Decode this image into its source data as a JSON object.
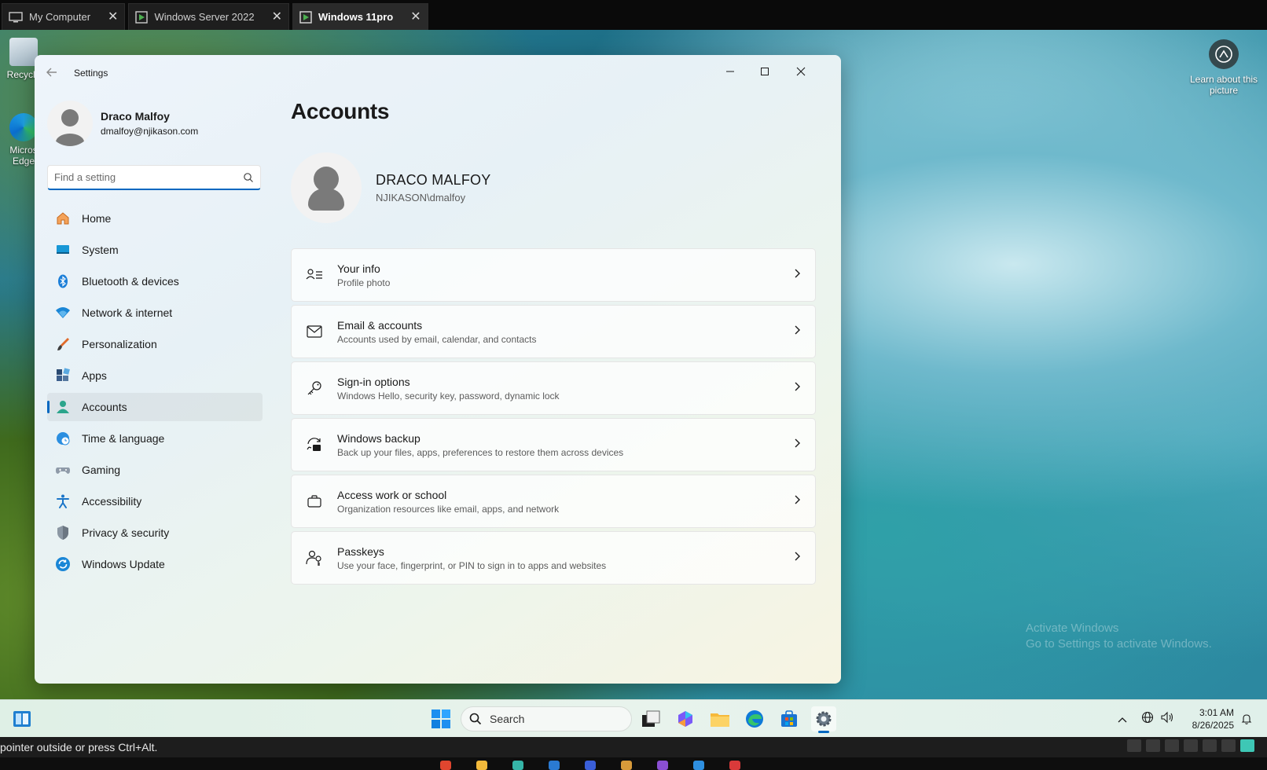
{
  "vm_tabs": [
    {
      "label": "My Computer",
      "active": false
    },
    {
      "label": "Windows Server 2022",
      "active": false
    },
    {
      "label": "Windows 11pro",
      "active": true
    }
  ],
  "desktop": {
    "icons": [
      {
        "label": "Recycle"
      },
      {
        "label": "Micros Edge"
      }
    ],
    "learn_picture": "Learn about this picture",
    "watermark_line1": "Activate Windows",
    "watermark_line2": "Go to Settings to activate Windows."
  },
  "settings": {
    "title": "Settings",
    "profile": {
      "name": "Draco Malfoy",
      "email": "dmalfoy@njikason.com"
    },
    "search": {
      "placeholder": "Find a setting"
    },
    "nav": [
      {
        "label": "Home",
        "icon": "home-icon"
      },
      {
        "label": "System",
        "icon": "system-icon"
      },
      {
        "label": "Bluetooth & devices",
        "icon": "bluetooth-icon"
      },
      {
        "label": "Network & internet",
        "icon": "wifi-icon"
      },
      {
        "label": "Personalization",
        "icon": "brush-icon"
      },
      {
        "label": "Apps",
        "icon": "apps-icon"
      },
      {
        "label": "Accounts",
        "icon": "accounts-icon",
        "active": true
      },
      {
        "label": "Time & language",
        "icon": "clock-globe-icon"
      },
      {
        "label": "Gaming",
        "icon": "gamepad-icon"
      },
      {
        "label": "Accessibility",
        "icon": "accessibility-icon"
      },
      {
        "label": "Privacy & security",
        "icon": "shield-icon"
      },
      {
        "label": "Windows Update",
        "icon": "update-icon"
      }
    ],
    "page_title": "Accounts",
    "account": {
      "name": "DRACO MALFOY",
      "domain": "NJIKASON\\dmalfoy"
    },
    "cards": [
      {
        "title": "Your info",
        "subtitle": "Profile photo",
        "icon": "person-list-icon"
      },
      {
        "title": "Email & accounts",
        "subtitle": "Accounts used by email, calendar, and contacts",
        "icon": "mail-icon"
      },
      {
        "title": "Sign-in options",
        "subtitle": "Windows Hello, security key, password, dynamic lock",
        "icon": "key-icon"
      },
      {
        "title": "Windows backup",
        "subtitle": "Back up your files, apps, preferences to restore them across devices",
        "icon": "backup-icon"
      },
      {
        "title": "Access work or school",
        "subtitle": "Organization resources like email, apps, and network",
        "icon": "briefcase-icon"
      },
      {
        "title": "Passkeys",
        "subtitle": "Use your face, fingerprint, or PIN to sign in to apps and websites",
        "icon": "passkey-icon"
      }
    ]
  },
  "taskbar": {
    "search_label": "Search",
    "time": "3:01 AM",
    "date": "8/26/2025"
  },
  "statusbar": {
    "message": "pointer outside or press Ctrl+Alt."
  },
  "colors": {
    "accent": "#0067c0"
  }
}
